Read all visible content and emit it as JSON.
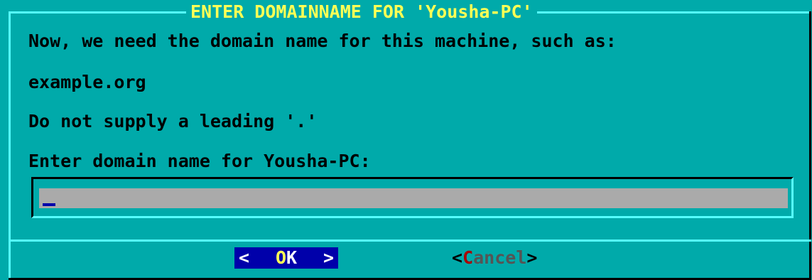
{
  "dialog": {
    "title": "ENTER DOMAINNAME FOR 'Yousha-PC'",
    "lines": [
      "Now, we need the domain name for this machine, such as:",
      "example.org",
      "Do not supply a leading '.'",
      "Enter domain name for Yousha-PC:"
    ],
    "input_value": ""
  },
  "buttons": {
    "ok_left": "<",
    "ok_hotkey": "O",
    "ok_rest": "K",
    "ok_right": ">",
    "cancel_open": "<",
    "cancel_hotkey": "C",
    "cancel_rest": "ancel",
    "cancel_close": ">"
  },
  "colors": {
    "background": "#00aaaa",
    "highlight": "#55ffff",
    "title": "#ffff55",
    "input_bg": "#aaaaaa",
    "selected_button": "#0000aa",
    "hotkey": "#aa0000"
  }
}
